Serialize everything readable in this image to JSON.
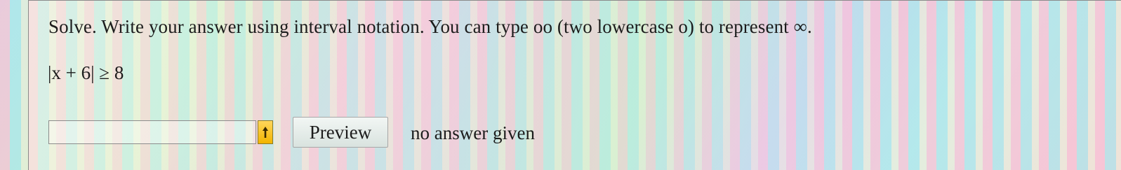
{
  "question": {
    "prompt": "Solve. Write your answer using interval notation. You can type oo (two lowercase o) to represent ∞.",
    "equation": "|x + 6| ≥ 8"
  },
  "answer": {
    "value": "",
    "placeholder": ""
  },
  "controls": {
    "preview_label": "Preview",
    "status_text": "no answer given",
    "arrow_icon": "up-arrow-icon"
  },
  "colors": {
    "arrow_button": "#f2b400",
    "preview_button": "#d9e3df"
  }
}
